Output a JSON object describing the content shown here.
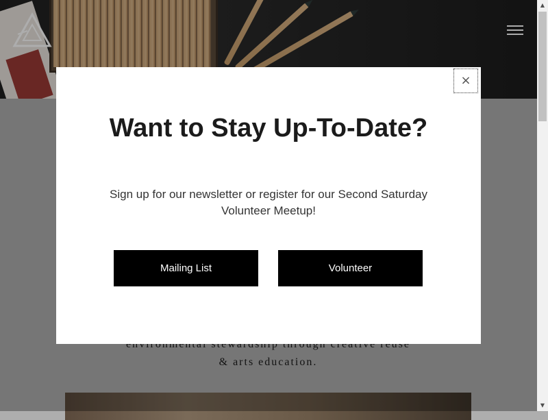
{
  "page": {
    "tagline_lines": [
      "environmental stewardship through creative reuse",
      "& arts education."
    ]
  },
  "modal": {
    "close_symbol": "×",
    "title": "Want to Stay Up-To-Date?",
    "text": "Sign up for our newsletter or register for our Second Saturday Volunteer Meetup!",
    "buttons": {
      "mailing_list": "Mailing List",
      "volunteer": "Volunteer"
    }
  },
  "scrollbar": {
    "up_arrow": "▲",
    "down_arrow": "▼"
  },
  "icons": {
    "logo": "triangle-logo-icon",
    "menu": "hamburger-menu-icon",
    "close": "close-icon"
  },
  "colors": {
    "button_bg": "#000000",
    "button_text": "#ffffff",
    "overlay": "rgba(0,0,0,0.32)",
    "page_bg": "#aeaeae"
  }
}
